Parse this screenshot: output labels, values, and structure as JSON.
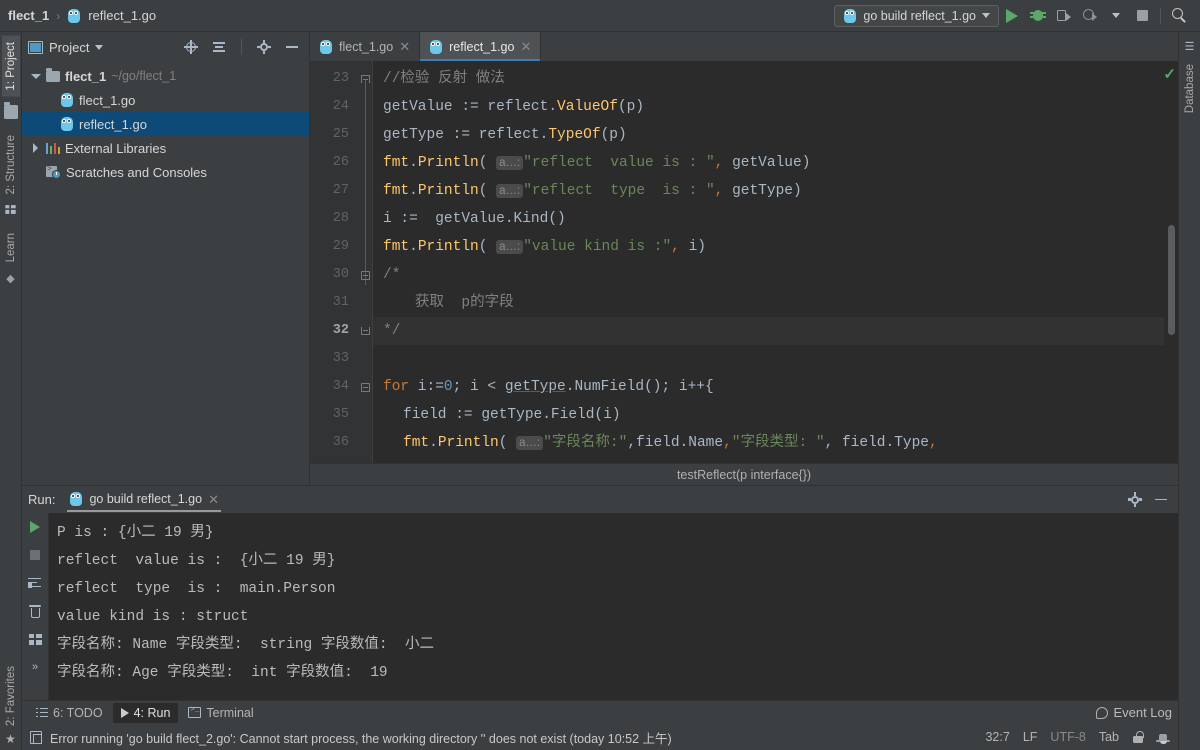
{
  "titlebar": {
    "breadcrumb": {
      "project": "flect_1",
      "separator": "›",
      "file": "reflect_1.go"
    },
    "run_config": {
      "label": "go build reflect_1.go"
    },
    "buttons": {
      "run": "Run",
      "debug": "Debug",
      "run_coverage": "Run with Coverage",
      "profiler": "Profiler",
      "stop": "Stop",
      "search": "Search Everywhere"
    }
  },
  "left_stripe": {
    "top": [
      {
        "label": "1: Project",
        "active": true
      },
      {
        "label": "2: Structure",
        "active": false
      },
      {
        "label": "Learn",
        "active": false
      }
    ],
    "bottom": [
      {
        "label": "2: Favorites",
        "active": false
      }
    ]
  },
  "right_stripe": {
    "items": [
      {
        "label": "Database"
      }
    ]
  },
  "project_panel": {
    "title": "Project",
    "tree": [
      {
        "label": "flect_1",
        "path": "~/go/flect_1",
        "icon": "folder-icon",
        "indent": 0,
        "arrow": "down",
        "bold": true,
        "selected": false
      },
      {
        "label": "flect_1.go",
        "path": "",
        "icon": "go-file-icon",
        "indent": 1,
        "arrow": "none",
        "bold": false,
        "selected": false
      },
      {
        "label": "reflect_1.go",
        "path": "",
        "icon": "go-file-icon",
        "indent": 1,
        "arrow": "none",
        "bold": false,
        "selected": true
      },
      {
        "label": "External Libraries",
        "path": "",
        "icon": "libraries-icon",
        "indent": 0,
        "arrow": "right",
        "bold": false,
        "selected": false
      },
      {
        "label": "Scratches and Consoles",
        "path": "",
        "icon": "scratches-icon",
        "indent": 0,
        "arrow": "none",
        "bold": false,
        "selected": false
      }
    ]
  },
  "editor": {
    "tabs": [
      {
        "label": "flect_1.go",
        "active": false
      },
      {
        "label": "reflect_1.go",
        "active": true
      }
    ],
    "breadcrumb_bottom": "testReflect(p interface{})",
    "lines": [
      {
        "n": "23",
        "current": false
      },
      {
        "n": "24",
        "current": false
      },
      {
        "n": "25",
        "current": false
      },
      {
        "n": "26",
        "current": false
      },
      {
        "n": "27",
        "current": false
      },
      {
        "n": "28",
        "current": false
      },
      {
        "n": "29",
        "current": false
      },
      {
        "n": "30",
        "current": false
      },
      {
        "n": "31",
        "current": false
      },
      {
        "n": "32",
        "current": true
      },
      {
        "n": "33",
        "current": false
      },
      {
        "n": "34",
        "current": false
      },
      {
        "n": "35",
        "current": false
      },
      {
        "n": "36",
        "current": false
      }
    ],
    "code": {
      "l23": "//检验 反射 做法",
      "l24_a": "getValue := ",
      "l24_b": "reflect",
      "l24_c": ".",
      "l24_d": "ValueOf",
      "l24_e": "(p)",
      "l25_a": "getType := ",
      "l25_b": "reflect",
      "l25_c": ".",
      "l25_d": "TypeOf",
      "l25_e": "(p)",
      "l26_fmt": "fmt",
      "l26_dot": ".",
      "l26_fn": "Println",
      "l26_open": "( ",
      "l26_hint": "a…:",
      "l26_str": "\"reflect  value is : \"",
      "l26_comma": ",",
      "l26_arg": " getValue)",
      "l27_str": "\"reflect  type  is : \"",
      "l27_arg": " getType)",
      "l28": "i :=  getValue.Kind()",
      "l29_str": "\"value kind is :\"",
      "l29_arg": " i)",
      "l30": "/*",
      "l31": "获取  p的字段",
      "l32": "*/",
      "l34_kw": "for",
      "l34_a": " i:=",
      "l34_num": "0",
      "l34_b": "; i < ",
      "l34_type": "getType",
      "l34_c": ".NumField(); i++{",
      "l35": "field := getType.Field(i)",
      "l36_str1": "\"字段名称:\"",
      "l36_mid1": ",field.Name",
      "l36_str2": "\"字段类型: \"",
      "l36_mid2": ", field.Type",
      "l36_tail": ","
    }
  },
  "run_panel": {
    "label": "Run:",
    "tab": "go build reflect_1.go",
    "console_lines": [
      "P is : {小二 19 男}",
      "reflect  value is :  {小二 19 男}",
      "reflect  type  is :  main.Person",
      "value kind is : struct",
      "字段名称: Name 字段类型:  string 字段数值:  小二",
      "字段名称: Age 字段类型:  int 字段数值:  19"
    ],
    "gutter_buttons": [
      "rerun-icon",
      "stop-icon",
      "soft-wrap-icon",
      "clear-all-icon",
      "print-icon",
      "expand-icon"
    ],
    "header_buttons": [
      "settings-icon",
      "hide-icon"
    ]
  },
  "bottom_tabs": [
    {
      "label": "6: TODO",
      "mnemonic": "6",
      "icon": "todo-list-icon",
      "active": false
    },
    {
      "label": "4: Run",
      "mnemonic": "4",
      "icon": "run-icon",
      "active": true
    },
    {
      "label": "Terminal",
      "mnemonic": "",
      "icon": "terminal-icon",
      "active": false
    }
  ],
  "statusbar": {
    "message": "Error running 'go build flect_2.go': Cannot start process, the working directory '' does not exist (today 10:52 上午)",
    "event_log": "Event Log",
    "caret": "32:7",
    "line_separator": "LF",
    "encoding": "UTF-8",
    "indent": "Tab"
  },
  "colors": {
    "accent": "#3d7fb5",
    "selection": "#0d4a78",
    "green": "#59a869",
    "editor_bg": "#2b2b2b",
    "panel_bg": "#3c3f41"
  }
}
